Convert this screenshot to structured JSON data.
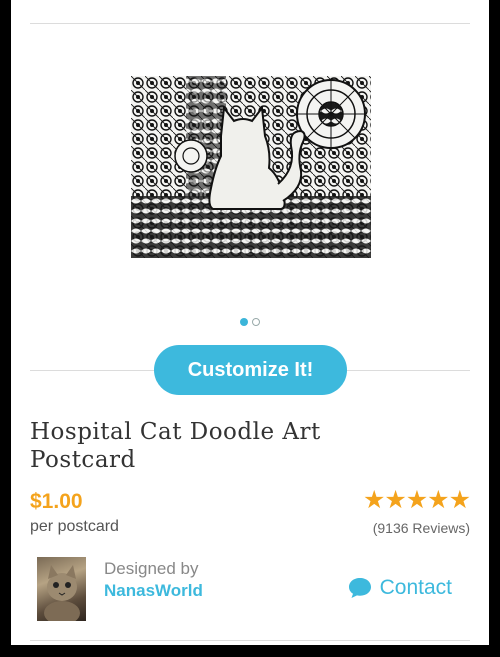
{
  "product": {
    "title_line1": "Hospital Cat Doodle Art",
    "title_line2": "Postcard",
    "price": "$1.00",
    "price_unit": "per postcard",
    "rating_stars": "★★★★★",
    "rating": 5,
    "reviews": "(9136 Reviews)"
  },
  "carousel": {
    "slide_count": 2,
    "active_index": 0
  },
  "actions": {
    "customize_label": "Customize It!",
    "contact_label": "Contact"
  },
  "designer": {
    "designed_by_label": "Designed by",
    "name": "NanasWorld"
  },
  "colors": {
    "accent": "#3db9dd",
    "price": "#f4a31c",
    "background": "#ffffff"
  },
  "icons": {
    "contact": "chat-bubble-icon",
    "rating": "star-icon"
  }
}
